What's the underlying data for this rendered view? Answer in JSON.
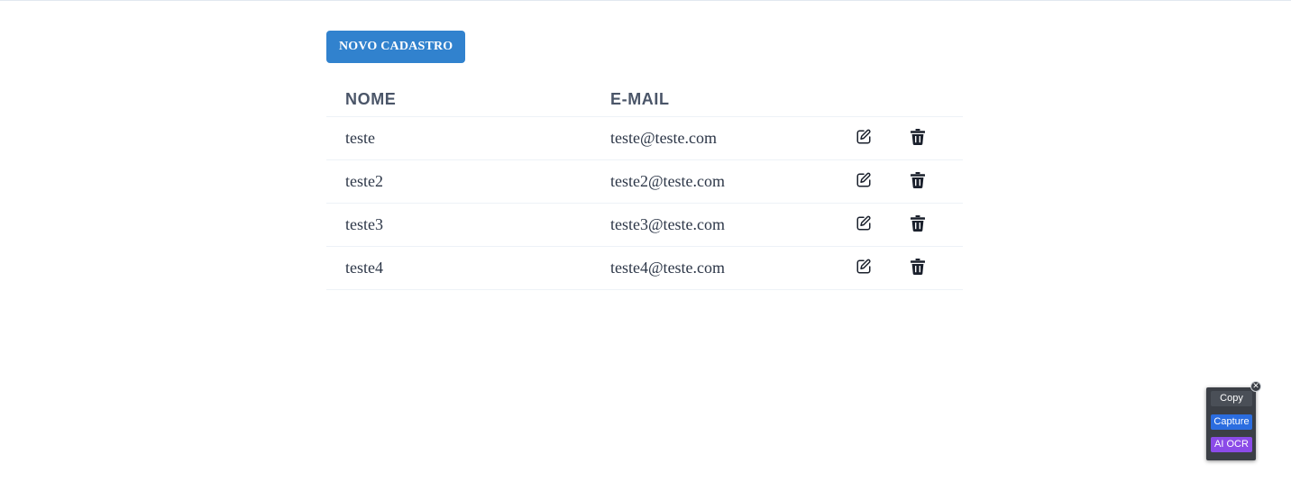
{
  "toolbar": {
    "new_button_label": "NOVO CADASTRO"
  },
  "table": {
    "headers": {
      "name": "NOME",
      "email": "E-MAIL"
    },
    "rows": [
      {
        "name": "teste",
        "email": "teste@teste.com"
      },
      {
        "name": "teste2",
        "email": "teste2@teste.com"
      },
      {
        "name": "teste3",
        "email": "teste3@teste.com"
      },
      {
        "name": "teste4",
        "email": "teste4@teste.com"
      }
    ],
    "row_icons": {
      "edit": "edit-icon",
      "delete": "trash-icon"
    }
  },
  "ocr_widget": {
    "copy_label": "Copy",
    "capture_label": "Capture",
    "ai_ocr_label": "AI OCR",
    "close_icon": "close-icon"
  },
  "colors": {
    "primary_button": "#3182ce",
    "header_text": "#4a5568",
    "body_text": "#2d3748",
    "row_border": "#edf2f7",
    "widget_bg": "#3b3f46",
    "capture_button": "#2b6de0",
    "ai_ocr_button": "#8b4be8"
  }
}
